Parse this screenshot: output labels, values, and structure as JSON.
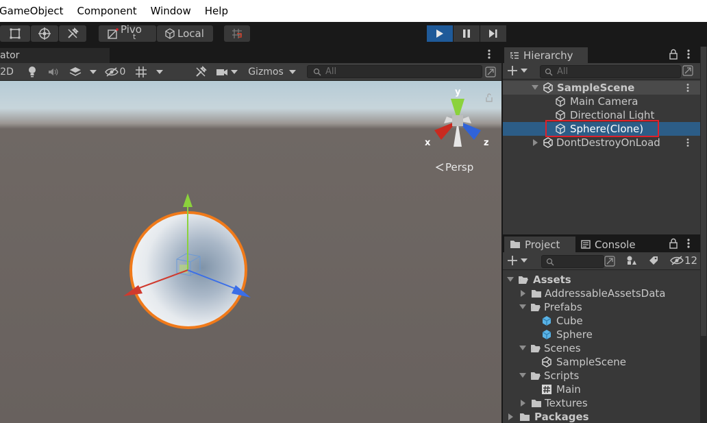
{
  "menu": [
    "GameObject",
    "Component",
    "Window",
    "Help"
  ],
  "toolbar": {
    "pivot_label": "Pivo",
    "pivot_sub": "t",
    "local_label": "Local"
  },
  "scene": {
    "tab_label": "ator",
    "mode_2d": "2D",
    "hidden_count": "0",
    "gizmos_label": "Gizmos",
    "search_placeholder": "All",
    "gizmo_labels": {
      "x": "x",
      "y": "y",
      "z": "z"
    },
    "persp_label": "Persp"
  },
  "hierarchy": {
    "tab_label": "Hierarchy",
    "search_placeholder": "All",
    "items": [
      {
        "label": "SampleScene",
        "kind": "scene"
      },
      {
        "label": "Main Camera",
        "kind": "object"
      },
      {
        "label": "Directional Light",
        "kind": "object"
      },
      {
        "label": "Sphere(Clone)",
        "kind": "object",
        "selected": true,
        "highlighted": true
      },
      {
        "label": "DontDestroyOnLoad",
        "kind": "scene"
      }
    ]
  },
  "project": {
    "tab_project": "Project",
    "tab_console": "Console",
    "hidden_count": "12",
    "tree": [
      {
        "label": "Assets",
        "type": "folder-open"
      },
      {
        "label": "AddressableAssetsData",
        "type": "folder"
      },
      {
        "label": "Prefabs",
        "type": "folder-open"
      },
      {
        "label": "Cube",
        "type": "prefab"
      },
      {
        "label": "Sphere",
        "type": "prefab"
      },
      {
        "label": "Scenes",
        "type": "folder-open"
      },
      {
        "label": "SampleScene",
        "type": "scene"
      },
      {
        "label": "Scripts",
        "type": "folder-open"
      },
      {
        "label": "Main",
        "type": "script"
      },
      {
        "label": "Textures",
        "type": "folder"
      },
      {
        "label": "Packages",
        "type": "folder"
      }
    ]
  },
  "colors": {
    "selection": "#2c5d87",
    "highlight_box": "#e0202a",
    "play_active": "#1f5a99",
    "prefab": "#5ab3e6",
    "sphere_outline": "#f07a1a"
  }
}
